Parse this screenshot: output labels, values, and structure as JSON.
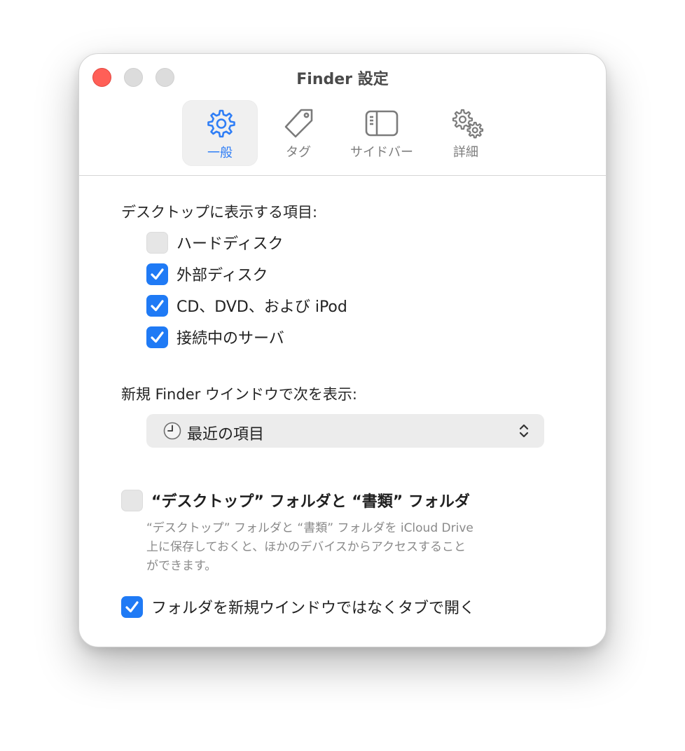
{
  "window": {
    "title": "Finder 設定"
  },
  "toolbar": {
    "tabs": [
      {
        "label": "一般",
        "icon": "gear-icon",
        "selected": true
      },
      {
        "label": "タグ",
        "icon": "tag-icon",
        "selected": false
      },
      {
        "label": "サイドバー",
        "icon": "sidebar-icon",
        "selected": false
      },
      {
        "label": "詳細",
        "icon": "gears-icon",
        "selected": false
      }
    ]
  },
  "desktop_section": {
    "heading": "デスクトップに表示する項目:",
    "items": [
      {
        "label": "ハードディスク",
        "checked": false
      },
      {
        "label": "外部ディスク",
        "checked": true
      },
      {
        "label": "CD、DVD、および iPod",
        "checked": true
      },
      {
        "label": "接続中のサーバ",
        "checked": true
      }
    ]
  },
  "new_window_section": {
    "heading": "新規 Finder ウインドウで次を表示:",
    "popup_value": "最近の項目",
    "popup_icon": "clock-icon"
  },
  "icloud_option": {
    "label": "“デスクトップ” フォルダと “書類” フォルダ",
    "checked": false,
    "help_lines": [
      "“デスクトップ” フォルダと “書類” フォルダを iCloud Drive",
      "上に保存しておくと、ほかのデバイスからアクセスすること",
      "ができます。"
    ]
  },
  "tabs_option": {
    "label": "フォルダを新規ウインドウではなくタブで開く",
    "checked": true
  },
  "colors": {
    "accent": "#1f7af5",
    "close_button": "#ff5f57"
  }
}
